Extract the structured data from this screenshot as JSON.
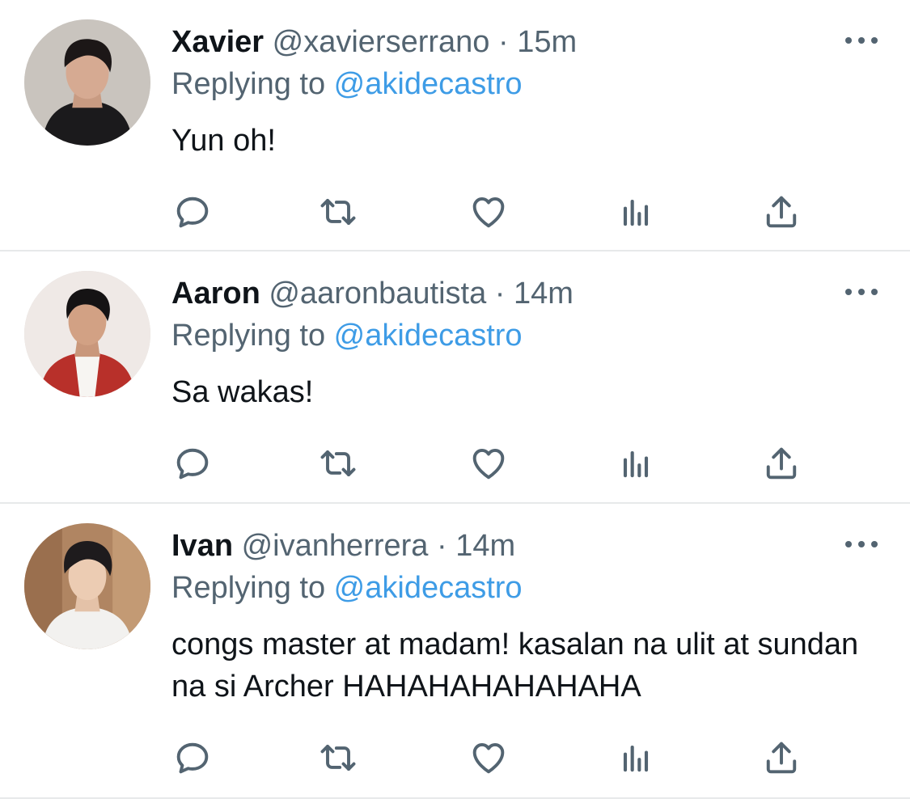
{
  "tweets": [
    {
      "name": "Xavier",
      "handle": "@xavierserrano",
      "separator": "·",
      "time": "15m",
      "replying_prefix": "Replying to ",
      "replying_to": "@akidecastro",
      "text": "Yun oh!"
    },
    {
      "name": "Aaron",
      "handle": "@aaronbautista",
      "separator": "·",
      "time": "14m",
      "replying_prefix": "Replying to ",
      "replying_to": "@akidecastro",
      "text": "Sa wakas!"
    },
    {
      "name": "Ivan",
      "handle": "@ivanherrera",
      "separator": "·",
      "time": "14m",
      "replying_prefix": "Replying to ",
      "replying_to": "@akidecastro",
      "text": "congs master at madam! kasalan na ulit at sundan na si Archer HAHAHAHAHAHAHA"
    }
  ],
  "icons": {
    "reply": "reply-icon",
    "retweet": "retweet-icon",
    "like": "heart-icon",
    "views": "analytics-icon",
    "share": "share-icon",
    "more": "more-icon"
  },
  "colors": {
    "text": "#0f1419",
    "secondary": "#536471",
    "link": "#3e9ce6",
    "divider": "#e7e9ea"
  }
}
